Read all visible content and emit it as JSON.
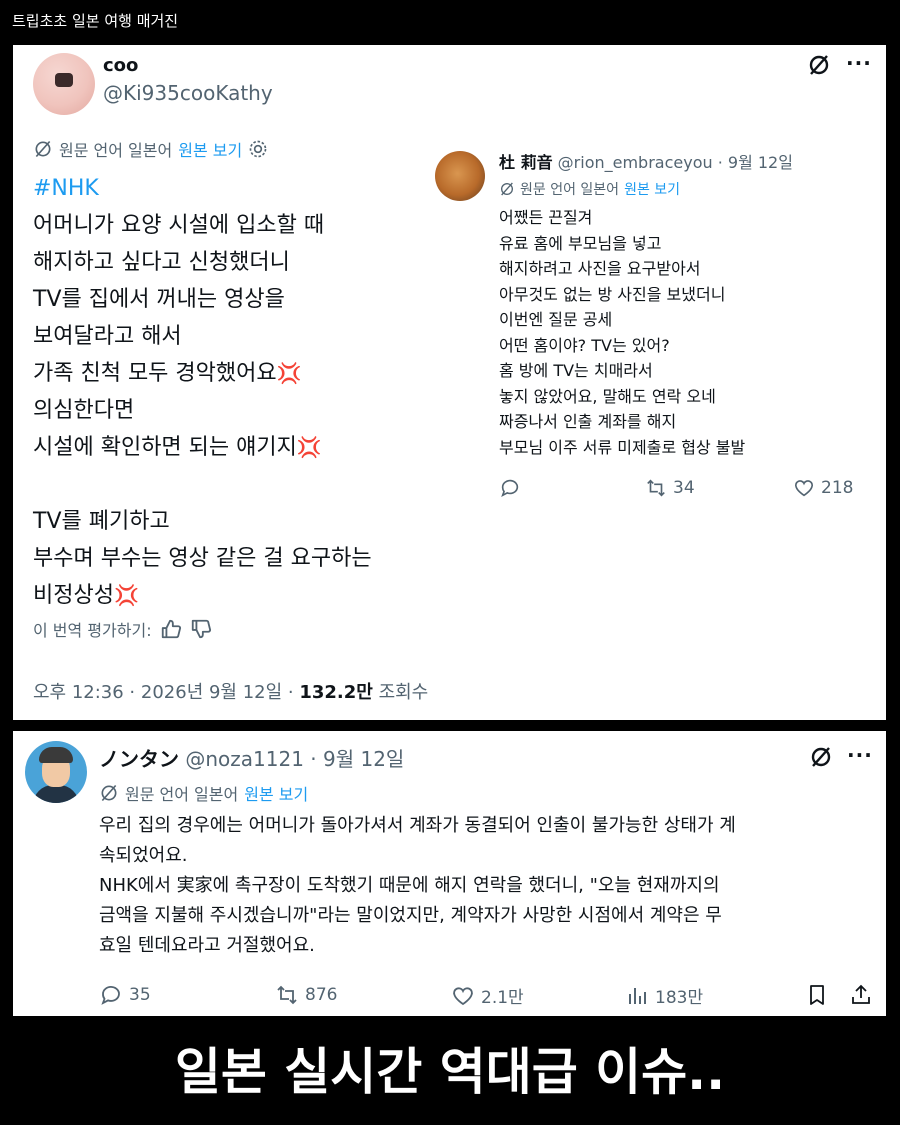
{
  "header": {
    "title": "트립초초 일본 여행 매거진"
  },
  "tweet1": {
    "name": "coo",
    "handle": "@Ki935cooKathy",
    "translation_prefix": "원문 언어 일본어",
    "show_original": "원본 보기",
    "hashtag": "#NHK",
    "lines": [
      "어머니가 요양 시설에 입소할 때",
      "해지하고 싶다고 신청했더니",
      "TV를 집에서 꺼내는 영상을",
      "보여달라고 해서",
      "가족 친척 모두 경악했어요",
      "의심한다면",
      "시설에 확인하면 되는 얘기지",
      "TV를 폐기하고",
      "부수며 부수는 영상 같은 걸 요구하는",
      "비정상성"
    ],
    "anger_emoji": "💢",
    "rate_label": "이 번역 평가하기:",
    "time": "오후 12:36 · 2026년 9월 12일 · ",
    "views_count": "132.2만",
    "views_label": " 조회수"
  },
  "reply": {
    "name": "杜 莉音",
    "handle_date": " @rion_embraceyou · 9월 12일",
    "translation_prefix": "원문 언어 일본어",
    "show_original": "원본 보기",
    "lines": [
      "어쨌든 끈질겨",
      "유료 홈에 부모님을 넣고",
      "해지하려고 사진을 요구받아서",
      "아무것도 없는 방 사진을 보냈더니",
      "이번엔 질문 공세",
      "어떤 홈이야? TV는 있어?",
      "홈 방에 TV는 치매라서",
      "놓지 않았어요, 말해도 연락 오네",
      "짜증나서 인출 계좌를 해지",
      "부모님 이주 서류 미제출로 협상 불발"
    ],
    "retweets": "34",
    "likes": "218"
  },
  "tweet2": {
    "name": "ノンタン",
    "handle_date": " @noza1121 · 9월 12일",
    "translation_prefix": "원문 언어 일본어",
    "show_original": "원본 보기",
    "lines": [
      "우리 집의 경우에는 어머니가 돌아가셔서 계좌가 동결되어 인출이 불가능한 상태가 계",
      "속되었어요.",
      "NHK에서 実家에 촉구장이 도착했기 때문에 해지 연락을 했더니, \"오늘 현재까지의",
      "금액을 지불해 주시겠습니까\"라는 말이었지만, 계약자가 사망한 시점에서 계약은 무",
      "효일 텐데요라고 거절했어요."
    ],
    "replies": "35",
    "retweets": "876",
    "likes": "2.1만",
    "views": "183만"
  },
  "footer": {
    "headline": "일본 실시간 역대급 이슈.."
  },
  "colors": {
    "link": "#1d9bf0",
    "muted": "#536471",
    "text": "#0f1419",
    "background": "#000000"
  }
}
